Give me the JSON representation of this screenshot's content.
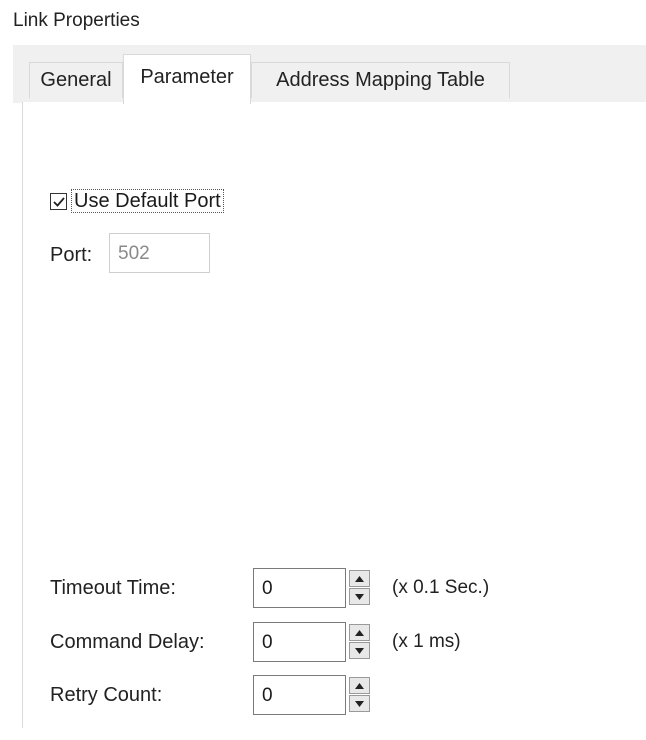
{
  "window": {
    "title": "Link Properties"
  },
  "tabs": [
    {
      "label": "General"
    },
    {
      "label": "Parameter"
    },
    {
      "label": "Address Mapping Table"
    }
  ],
  "port_settings": {
    "use_default_port_label": "Use Default Port",
    "use_default_port_checked": true,
    "port_label": "Port:",
    "port_value": "502"
  },
  "fields": {
    "timeout": {
      "label": "Timeout Time:",
      "value": "0",
      "unit": "(x 0.1 Sec.)"
    },
    "command_delay": {
      "label": "Command Delay:",
      "value": "0",
      "unit": "(x 1 ms)"
    },
    "retry_count": {
      "label": "Retry Count:",
      "value": "0"
    }
  },
  "icons": {
    "checkbox_check": "check-icon",
    "spin_up": "arrow-up-icon",
    "spin_down": "arrow-down-icon"
  }
}
